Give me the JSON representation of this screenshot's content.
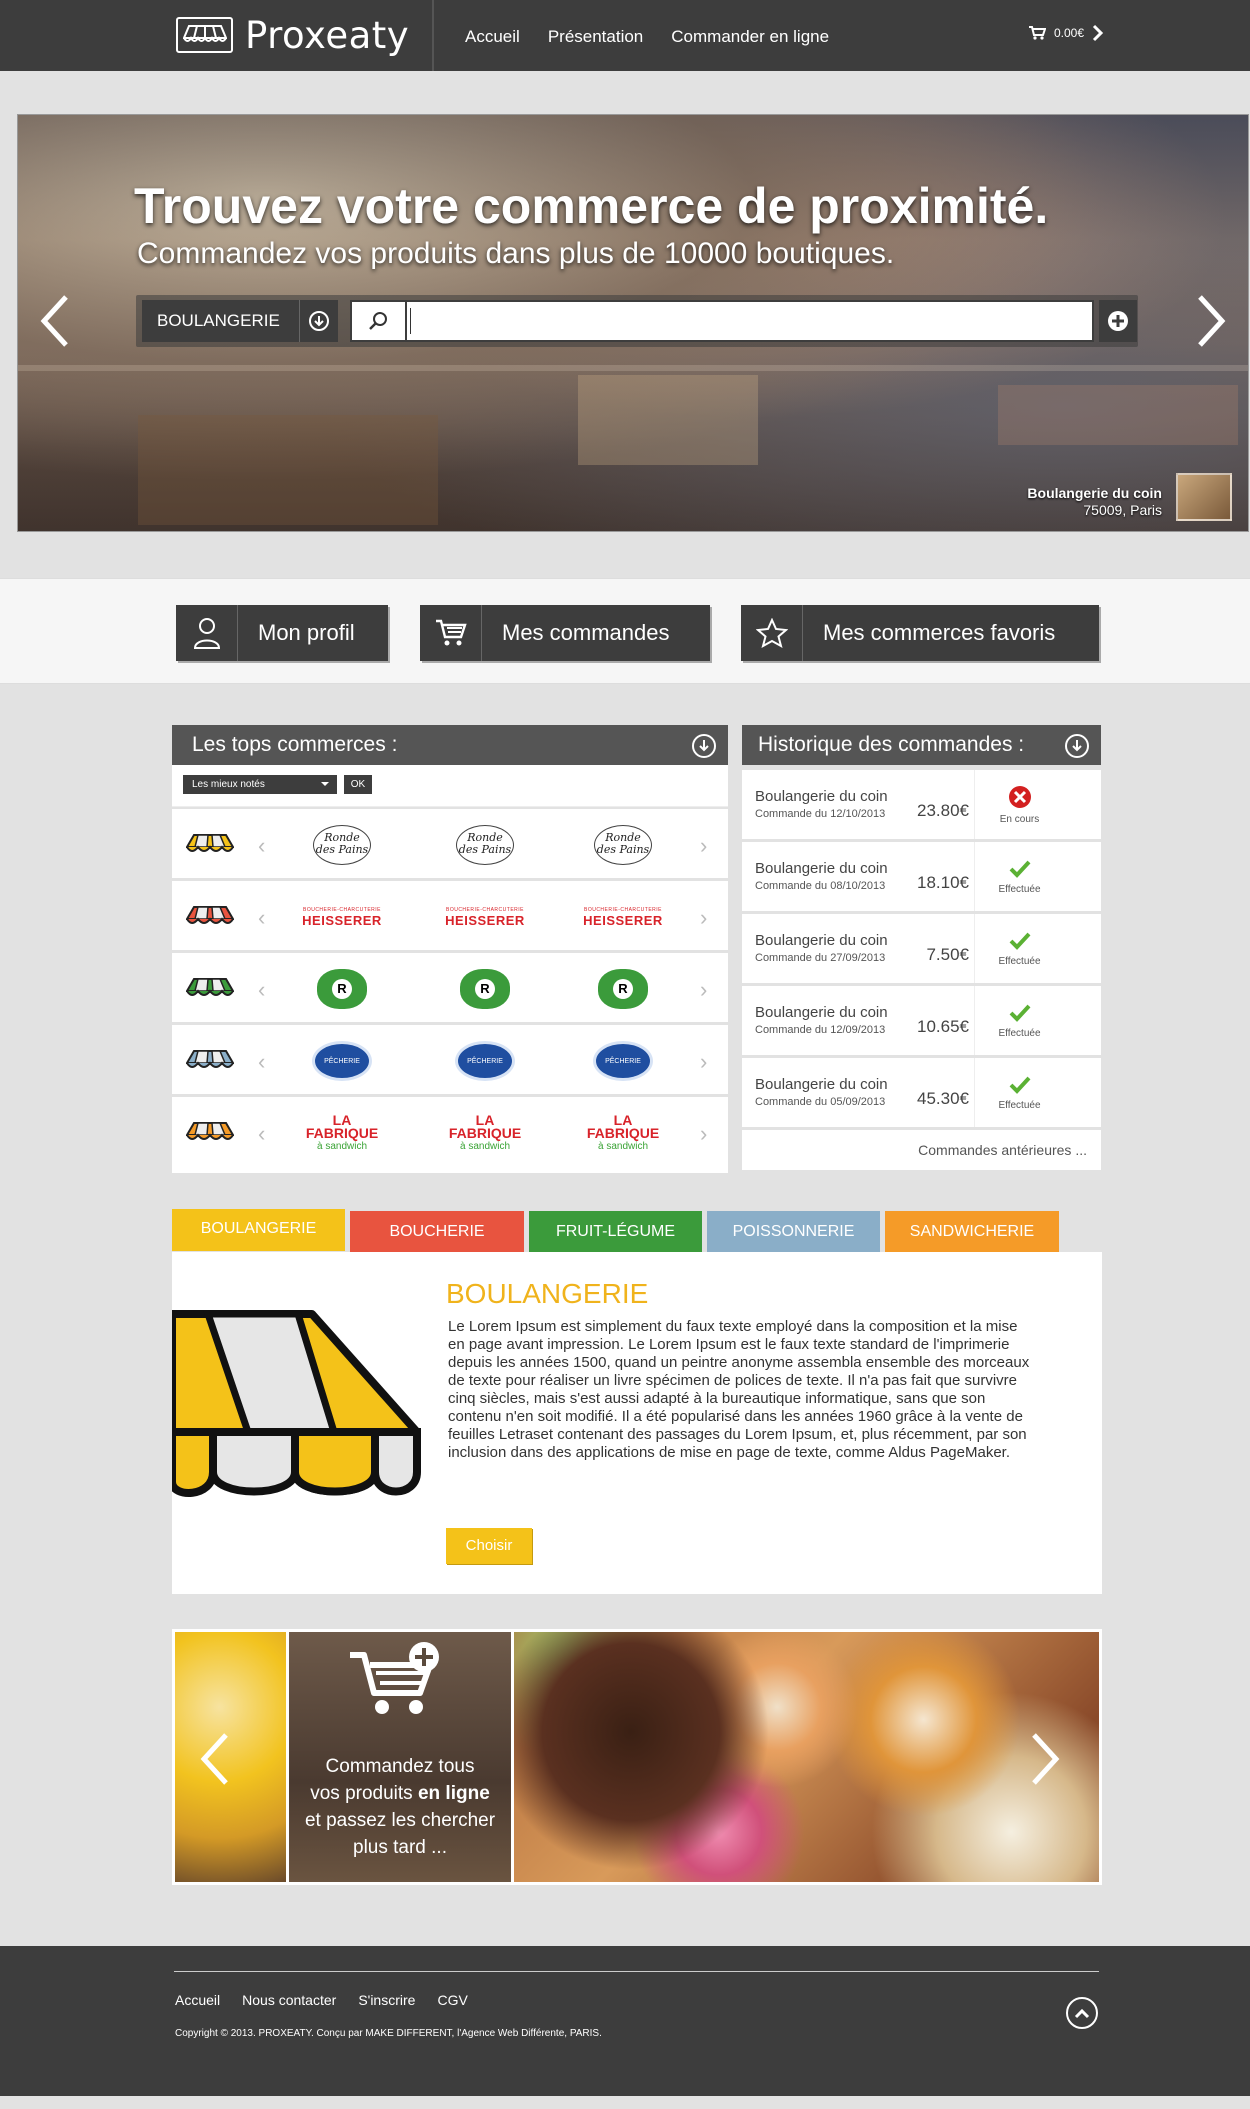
{
  "header": {
    "logo_text": "Proxeaty",
    "nav": [
      {
        "label": "Accueil"
      },
      {
        "label": "Présentation"
      },
      {
        "label": "Commander en ligne"
      }
    ],
    "cart_total": "0.00€"
  },
  "hero": {
    "title": "Trouvez votre commerce de proximité.",
    "subtitle": "Commandez vos produits dans plus de 10000 boutiques.",
    "category_select": "BOULANGERIE",
    "search_value": "",
    "caption_shop": "Boulangerie du coin",
    "caption_location": "75009, Paris"
  },
  "profile_buttons": [
    {
      "label": "Mon profil",
      "icon": "user-icon"
    },
    {
      "label": "Mes commandes",
      "icon": "cart-icon"
    },
    {
      "label": "Mes commerces favoris",
      "icon": "star-icon"
    }
  ],
  "top_shops": {
    "title": "Les tops commerces :",
    "filter_value": "Les mieux notés",
    "ok_label": "OK",
    "rows": [
      {
        "category": "boulangerie",
        "color": "#f4c219",
        "brand": "Ronde des Pains"
      },
      {
        "category": "boucherie",
        "color": "#e8543f",
        "brand": "HEISSERER"
      },
      {
        "category": "fruit-legume",
        "color": "#3b9b3b",
        "brand": "R"
      },
      {
        "category": "poissonnerie",
        "color": "#8aaec8",
        "brand": "PÊCHERIE"
      },
      {
        "category": "sandwicherie",
        "color": "#f59b28",
        "brand": "LA FABRIQUE"
      }
    ],
    "brand_labels": {
      "ronde_1": "Ronde",
      "ronde_2": "des Pains",
      "heis_small": "BOUCHERIE-CHARCUTERIE",
      "heis": "HEISSERER",
      "r": "R",
      "pech": "PÊCHERIE",
      "fab": "LA FABRIQUE",
      "fab_small": "à sandwich"
    }
  },
  "history": {
    "title": "Historique des commandes :",
    "orders": [
      {
        "shop": "Boulangerie du coin",
        "date": "Commande du 12/10/2013",
        "amount": "23.80€",
        "status": "En cours"
      },
      {
        "shop": "Boulangerie du coin",
        "date": "Commande du 08/10/2013",
        "amount": "18.10€",
        "status": "Effectuée"
      },
      {
        "shop": "Boulangerie du coin",
        "date": "Commande du 27/09/2013",
        "amount": "7.50€",
        "status": "Effectuée"
      },
      {
        "shop": "Boulangerie du coin",
        "date": "Commande du 12/09/2013",
        "amount": "10.65€",
        "status": "Effectuée"
      },
      {
        "shop": "Boulangerie du coin",
        "date": "Commande du 05/09/2013",
        "amount": "45.30€",
        "status": "Effectuée"
      }
    ],
    "more_label": "Commandes antérieures ..."
  },
  "categories": {
    "tabs": [
      {
        "label": "BOULANGERIE",
        "color": "#f4c219"
      },
      {
        "label": "BOUCHERIE",
        "color": "#e8543f"
      },
      {
        "label": "FRUIT-LÉGUME",
        "color": "#3b9b3b"
      },
      {
        "label": "POISSONNERIE",
        "color": "#8aaec8"
      },
      {
        "label": "SANDWICHERIE",
        "color": "#f59b28"
      }
    ],
    "active": {
      "title": "BOULANGERIE",
      "description": "Le Lorem Ipsum est simplement du faux texte employé dans la composition et la mise en page avant impression. Le Lorem Ipsum est le faux texte standard de l'imprimerie depuis les années 1500, quand un peintre anonyme assembla ensemble des morceaux de texte pour réaliser un livre spécimen de polices de texte. Il n'a pas fait que survivre cinq siècles, mais s'est aussi adapté à la bureautique informatique, sans que son contenu n'en soit modifié. Il a été popularisé dans les années 1960 grâce à la vente de feuilles Letraset contenant des passages du Lorem Ipsum, et, plus récemment, par son inclusion dans des applications de mise en page de texte, comme Aldus PageMaker.",
      "button": "Choisir"
    }
  },
  "promo": {
    "line1": "Commandez tous",
    "line2a": "vos produits ",
    "line2b": "en ligne",
    "line3": "et passez les chercher",
    "line4": "plus tard ..."
  },
  "footer": {
    "links": [
      {
        "label": "Accueil"
      },
      {
        "label": "Nous contacter"
      },
      {
        "label": "S'inscrire"
      },
      {
        "label": "CGV"
      }
    ],
    "copyright": "Copyright © 2013. PROXEATY. Conçu par MAKE DIFFERENT, l'Agence Web Différente, PARIS."
  },
  "colors": {
    "dark": "#3d3d3d",
    "accent_yellow": "#f4c219",
    "success": "#5bb134",
    "error": "#d32020"
  }
}
